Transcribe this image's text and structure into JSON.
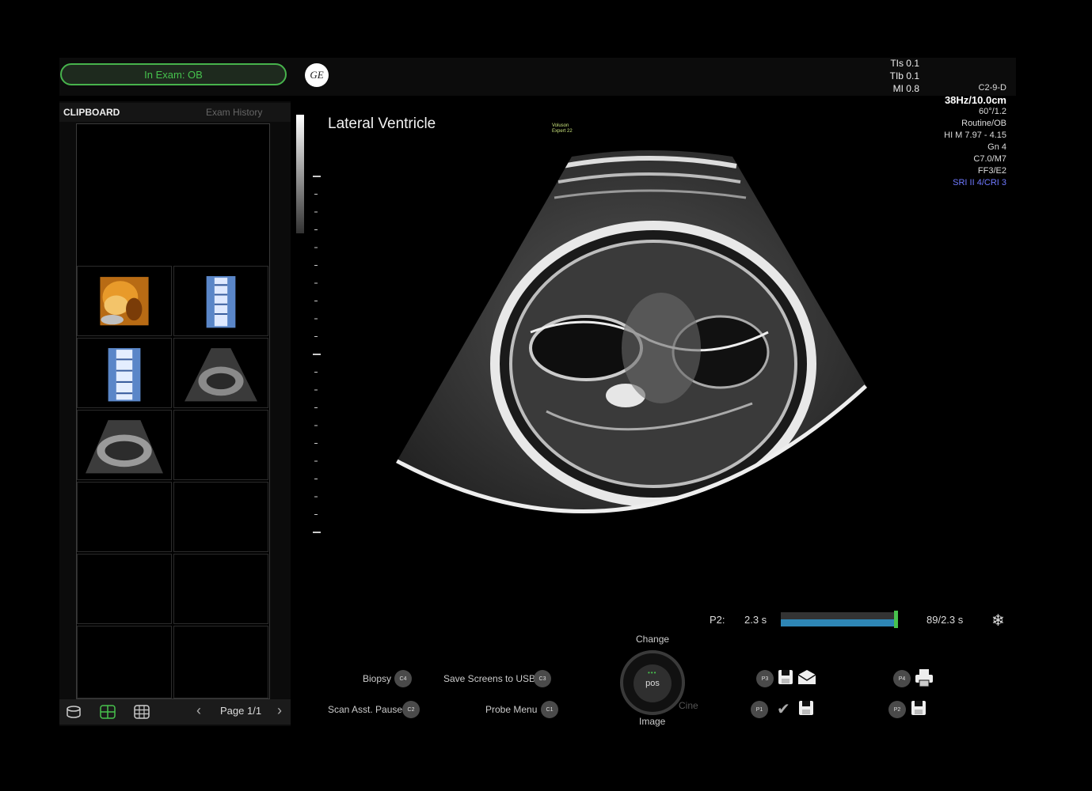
{
  "header": {
    "exam_status": "In Exam: OB",
    "logo_text": "GE"
  },
  "acoustic": {
    "tis": "TIs 0.1",
    "tib": "TIb 0.1",
    "mi": "MI 0.8"
  },
  "params": {
    "probe": "C2-9-D",
    "frame_depth": "38Hz/10.0cm",
    "angle": "60°/1.2",
    "preset": "Routine/OB",
    "harmonic": "HI M 7.97 - 4.15",
    "gain": "Gn 4",
    "map": "C7.0/M7",
    "ff": "FF3/E2",
    "sri": "SRI II 4/CRI 3"
  },
  "clipboard": {
    "title": "CLIPBOARD",
    "exam_history": "Exam History",
    "page": "Page 1/1"
  },
  "image": {
    "title": "Lateral Ventricle",
    "mini_label_1": "Voluson",
    "mini_label_2": "Expert 22"
  },
  "cine": {
    "label": "P2:",
    "time": "2.3 s",
    "frames": "89/2.3 s",
    "progress": 1.0
  },
  "controls": {
    "biopsy": "Biopsy",
    "biopsy_key": "C4",
    "save_usb": "Save Screens to USB",
    "save_usb_key": "C3",
    "scan_asst": "Scan Asst. Pause",
    "scan_asst_key": "C2",
    "probe_menu": "Probe Menu",
    "probe_menu_key": "C1",
    "dial_top": "Change",
    "dial_center": "pos",
    "dial_bottom": "Image",
    "dial_right": "Cine",
    "p3": "P3",
    "p4": "P4",
    "p1": "P1",
    "p2": "P2"
  },
  "colors": {
    "accent_green": "#47b34c",
    "cine_blue": "#2e86b5",
    "sri_blue": "#6f79ff"
  }
}
